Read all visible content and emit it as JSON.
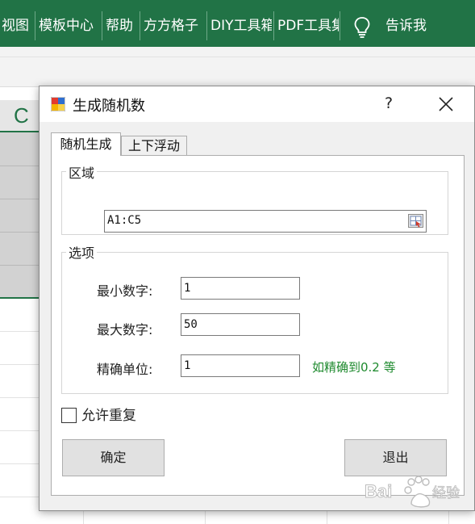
{
  "ribbon": {
    "tabs": [
      "视图",
      "模板中心",
      "帮助",
      "方方格子",
      "DIY工具箱",
      "PDF工具集"
    ],
    "tell_me": "告诉我"
  },
  "sheet": {
    "column_letter": "C"
  },
  "dialog": {
    "title": "生成随机数",
    "help": "?",
    "tabs": [
      "随机生成",
      "上下浮动"
    ],
    "range_group": {
      "label": "区域",
      "value": "A1:C5"
    },
    "options_group": {
      "label": "选项",
      "min_label": "最小数字:",
      "min_value": "1",
      "max_label": "最大数字:",
      "max_value": "50",
      "precision_label": "精确单位:",
      "precision_value": "1",
      "precision_hint": "如精确到0.2 等"
    },
    "allow_repeat": {
      "label": "允许重复",
      "checked": false
    },
    "ok_label": "确定",
    "exit_label": "退出"
  },
  "watermark": {
    "text": "Baidu 经验"
  },
  "colors": {
    "ribbon": "#217346",
    "hint": "#1e8a2e"
  }
}
